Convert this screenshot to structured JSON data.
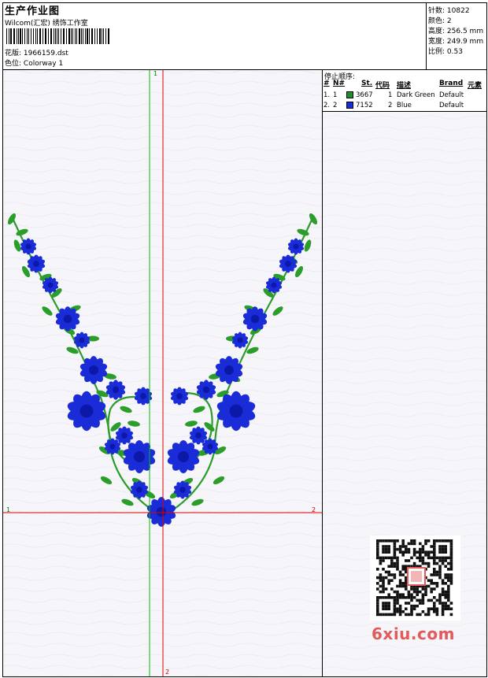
{
  "header": {
    "title": "生产作业图",
    "subtitle": "Wilcom(汇宏) 绣饰工作室",
    "pattern_label": "花版:",
    "pattern_value": "1966159.dst",
    "colorway_label": "色位:",
    "colorway_value": "Colorway 1"
  },
  "stats": [
    {
      "label": "针数:",
      "value": "10822"
    },
    {
      "label": "颜色:",
      "value": "2"
    },
    {
      "label": "高度:",
      "value": "256.5 mm"
    },
    {
      "label": "宽度:",
      "value": "249.9 mm"
    },
    {
      "label": "比例:",
      "value": "0.53"
    }
  ],
  "stop_sequence": {
    "title": "停止顺序:",
    "headers": [
      "#",
      "N#",
      "St.",
      "代码",
      "描述",
      "Brand",
      "元素"
    ],
    "rows": [
      {
        "idx": "1.",
        "n": "1",
        "stitch": "3667",
        "code": "1",
        "desc": "Dark Green",
        "brand": "Default",
        "color": "#1f8f2a"
      },
      {
        "idx": "2.",
        "n": "2",
        "stitch": "7152",
        "code": "2",
        "desc": "Blue",
        "brand": "Default",
        "color": "#1a2bd8"
      }
    ]
  },
  "axes": {
    "green_top": "1",
    "red_bottom": "2",
    "red_left": "1",
    "red_right": "2"
  },
  "colors": {
    "thread_green": "#2a9d2a",
    "thread_blue": "#1a2bd8",
    "axis_green": "#00c000",
    "axis_red": "#e00000"
  },
  "watermark": {
    "text": "6xiu.com"
  }
}
